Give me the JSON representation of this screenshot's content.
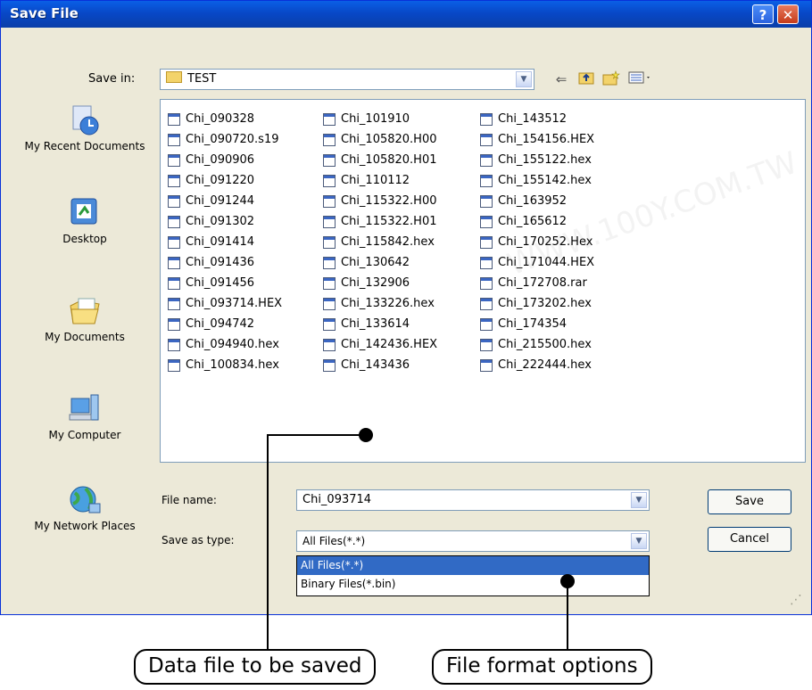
{
  "dialog": {
    "title": "Save File",
    "help_glyph": "?",
    "close_glyph": "✕"
  },
  "save_in": {
    "label": "Save in:",
    "value": "TEST"
  },
  "places": [
    {
      "label": "My Recent Documents",
      "icon": "recent-documents-icon"
    },
    {
      "label": "Desktop",
      "icon": "desktop-icon"
    },
    {
      "label": "My Documents",
      "icon": "my-documents-icon"
    },
    {
      "label": "My Computer",
      "icon": "my-computer-icon"
    },
    {
      "label": "My Network Places",
      "icon": "network-places-icon"
    }
  ],
  "files": {
    "col1": [
      "Chi_090328",
      "Chi_090720.s19",
      "Chi_090906",
      "Chi_091220",
      "Chi_091244",
      "Chi_091302",
      "Chi_091414",
      "Chi_091436",
      "Chi_091456",
      "Chi_093714.HEX",
      "Chi_094742",
      "Chi_094940.hex",
      "Chi_100834.hex"
    ],
    "col2": [
      "Chi_101910",
      "Chi_105820.H00",
      "Chi_105820.H01",
      "Chi_110112",
      "Chi_115322.H00",
      "Chi_115322.H01",
      "Chi_115842.hex",
      "Chi_130642",
      "Chi_132906",
      "Chi_133226.hex",
      "Chi_133614",
      "Chi_142436.HEX",
      "Chi_143436"
    ],
    "col3": [
      "Chi_143512",
      "Chi_154156.HEX",
      "Chi_155122.hex",
      "Chi_155142.hex",
      "Chi_163952",
      "Chi_165612",
      "Chi_170252.Hex",
      "Chi_171044.HEX",
      "Chi_172708.rar",
      "Chi_173202.hex",
      "Chi_174354",
      "Chi_215500.hex",
      "Chi_222444.hex"
    ]
  },
  "filename": {
    "label": "File name:",
    "value": "Chi_093714"
  },
  "savetype": {
    "label": "Save as type:",
    "value": "All Files(*.*)",
    "options": [
      "All Files(*.*)",
      "Binary Files(*.bin)"
    ]
  },
  "buttons": {
    "save": "Save",
    "cancel": "Cancel"
  },
  "callouts": {
    "data_file": "Data file to be saved",
    "format": "File format options"
  },
  "watermark": "WWW.100Y.COM.TW"
}
